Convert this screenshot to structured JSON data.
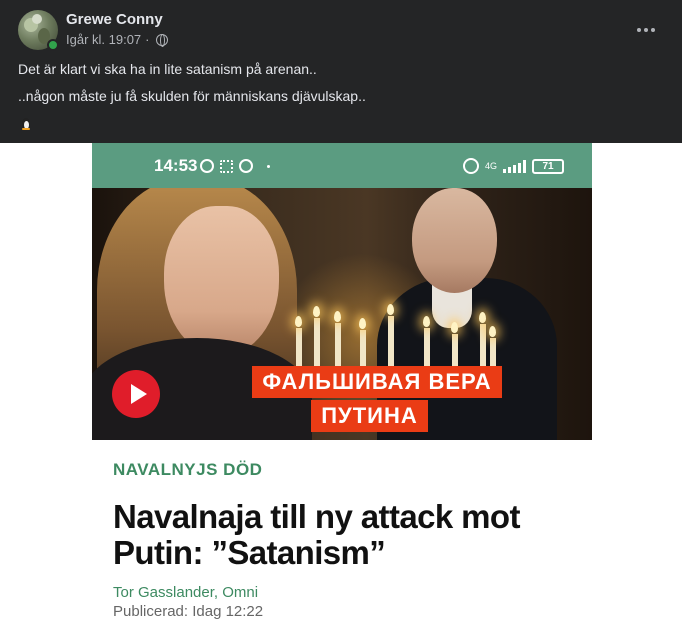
{
  "post": {
    "author": "Grewe Conny",
    "timestamp": "Igår kl. 19:07",
    "separator": "·",
    "audience_icon": "globe-icon",
    "text_line1": "Det är klart vi ska ha in lite satanism på arenan..",
    "text_line2": "..någon måste ju få skulden för människans djävulskap..",
    "emoji": "penguin"
  },
  "phone_status": {
    "time": "14:53",
    "network": "4G",
    "battery": "71"
  },
  "video": {
    "caption_line1": "ФАЛЬШИВАЯ ВЕРА",
    "caption_line2": "ПУТИНА"
  },
  "article": {
    "category": "NAVALNYJS DÖD",
    "headline_line1": "Navalnaja till ny attack mot",
    "headline_line2": "Putin: ”Satanism”",
    "author": "Tor Gasslander, Omni",
    "published": "Publicerad: Idag 12:22"
  },
  "colors": {
    "background": "#242526",
    "text": "#e4e6eb",
    "muted": "#b0b3b8",
    "online": "#31a24c",
    "omni_green": "#3d8a61",
    "status_bar": "#5b9c81",
    "caption_red": "#ea3c15",
    "play_red": "#e01d2a"
  }
}
